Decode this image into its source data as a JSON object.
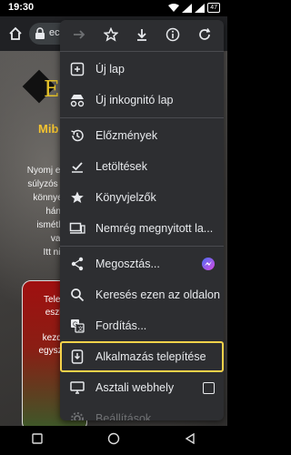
{
  "status": {
    "time": "19:30",
    "battery": "47"
  },
  "toolbar": {
    "url": "ec"
  },
  "page": {
    "logo_text": "E",
    "subtitle": "Mib",
    "paragraph": [
      "Nyomj eg",
      "súlyzós e",
      "könnyer",
      "hány",
      "ismétlé",
      "van",
      "Itt nin"
    ],
    "card": [
      "Telep",
      "eszk",
      "",
      "kezdő",
      "egyszer"
    ]
  },
  "menu": {
    "items": [
      {
        "label": "Új lap",
        "icon": "new-tab-icon"
      },
      {
        "label": "Új inkognitó lap",
        "icon": "incognito-icon"
      },
      {
        "label": "Előzmények",
        "icon": "history-icon"
      },
      {
        "label": "Letöltések",
        "icon": "downloads-check-icon"
      },
      {
        "label": "Könyvjelzők",
        "icon": "star-filled-icon"
      },
      {
        "label": "Nemrég megnyitott la...",
        "icon": "recent-tabs-icon"
      },
      {
        "label": "Megosztás...",
        "icon": "share-icon"
      },
      {
        "label": "Keresés ezen az oldalon",
        "icon": "find-in-page-icon"
      },
      {
        "label": "Fordítás...",
        "icon": "translate-icon"
      },
      {
        "label": "Alkalmazás telepítése",
        "icon": "install-app-icon"
      },
      {
        "label": "Asztali webhely",
        "icon": "desktop-site-icon"
      },
      {
        "label": "Beállítások",
        "icon": "settings-icon"
      }
    ]
  },
  "colors": {
    "highlight": "#f5d24a",
    "menu_bg": "#2d2e31",
    "accent_gold": "#e6c32a"
  }
}
